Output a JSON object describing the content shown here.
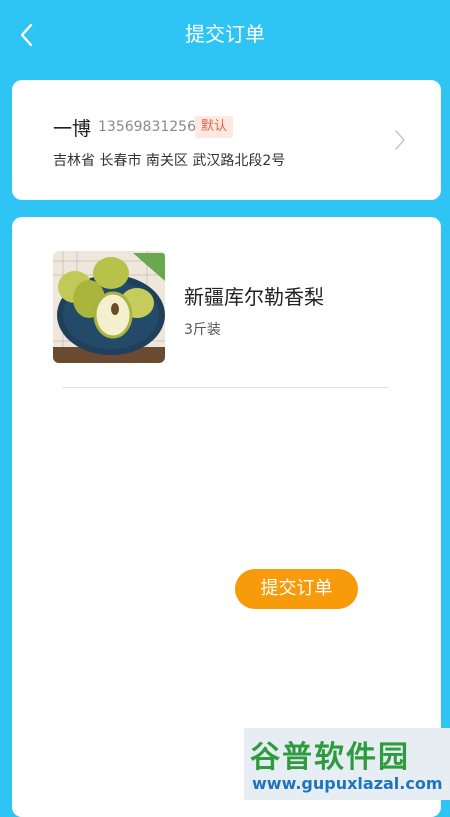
{
  "header": {
    "title": "提交订单",
    "back_icon": "chevron-left-icon"
  },
  "address": {
    "name": "一博",
    "phone": "13569831256",
    "badge": "默认",
    "full_address": "吉林省 长春市 南关区 武汉路北段2号",
    "chevron_icon": "chevron-right-icon"
  },
  "product": {
    "name": "新疆库尔勒香梨",
    "spec": "3斤装",
    "image": "pear-product-image"
  },
  "actions": {
    "submit_label": "提交订单"
  },
  "watermark": {
    "title": "谷普软件园",
    "url": "www.gupuxlazal.com"
  },
  "colors": {
    "background": "#2ec5f5",
    "accent": "#f79b0b",
    "badge_bg": "#fde9e2",
    "badge_text": "#e0664a"
  }
}
